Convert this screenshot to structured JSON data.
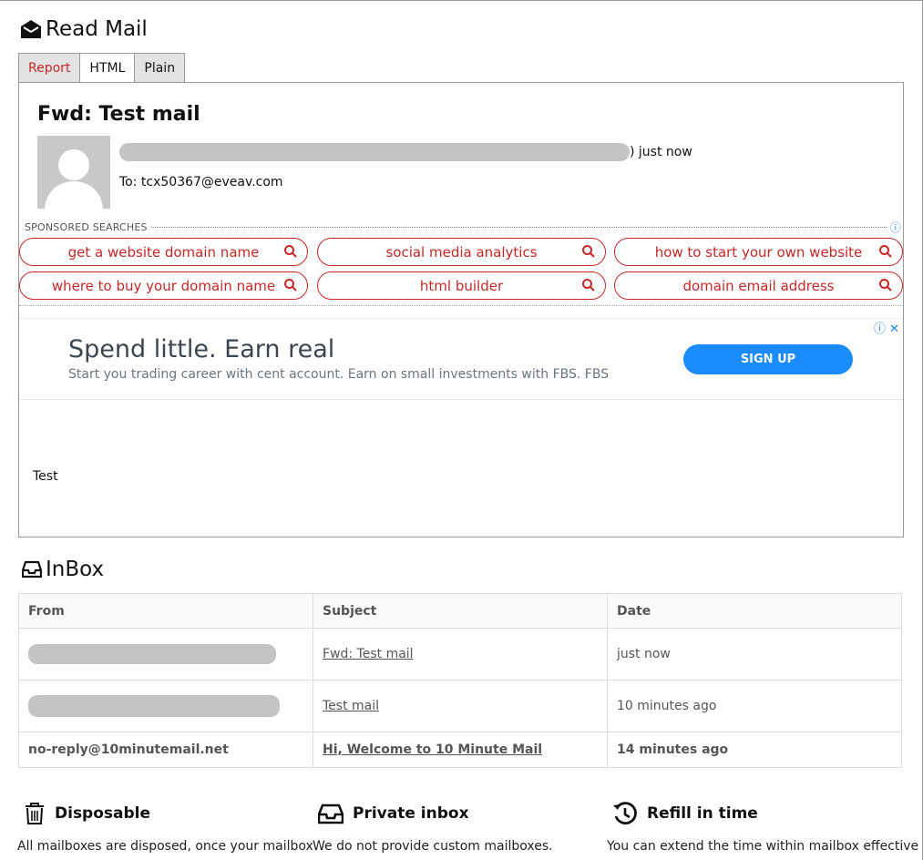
{
  "read_mail": {
    "title": "Read Mail",
    "tabs": [
      "Report",
      "HTML",
      "Plain"
    ],
    "message": {
      "subject": "Fwd: Test mail",
      "from_suffix": ") just now",
      "to": "To: tcx50367@eveav.com",
      "body": "Test"
    },
    "sponsored": {
      "label": "SPONSORED SEARCHES",
      "searches": [
        "get a website domain name",
        "social media analytics",
        "how to start your own website",
        "where to buy your domain name",
        "html builder",
        "domain email address"
      ]
    },
    "ad": {
      "headline": "Spend little. Earn real",
      "text": "Start you trading career with cent account. Earn on small investments with FBS. FBS",
      "button": "SIGN UP"
    }
  },
  "inbox": {
    "title": "InBox",
    "columns": [
      "From",
      "Subject",
      "Date"
    ],
    "rows": [
      {
        "from": "",
        "subject": "Fwd: Test mail",
        "date": "just now"
      },
      {
        "from": "",
        "subject": "Test mail",
        "date": "10 minutes ago"
      },
      {
        "from": "no-reply@10minutemail.net",
        "subject": "Hi, Welcome to 10 Minute Mail",
        "date": "14 minutes ago"
      }
    ]
  },
  "features": [
    {
      "title": "Disposable",
      "text": "All mailboxes are disposed, once your mailbox"
    },
    {
      "title": "Private inbox",
      "text": "We do not provide custom mailboxes."
    },
    {
      "title": "Refill in time",
      "text": "You can extend the time within mailbox effective"
    }
  ],
  "colors": {
    "accent_red": "#c62828",
    "ad_button": "#1a8cff",
    "info_blue": "#1e88e5"
  }
}
